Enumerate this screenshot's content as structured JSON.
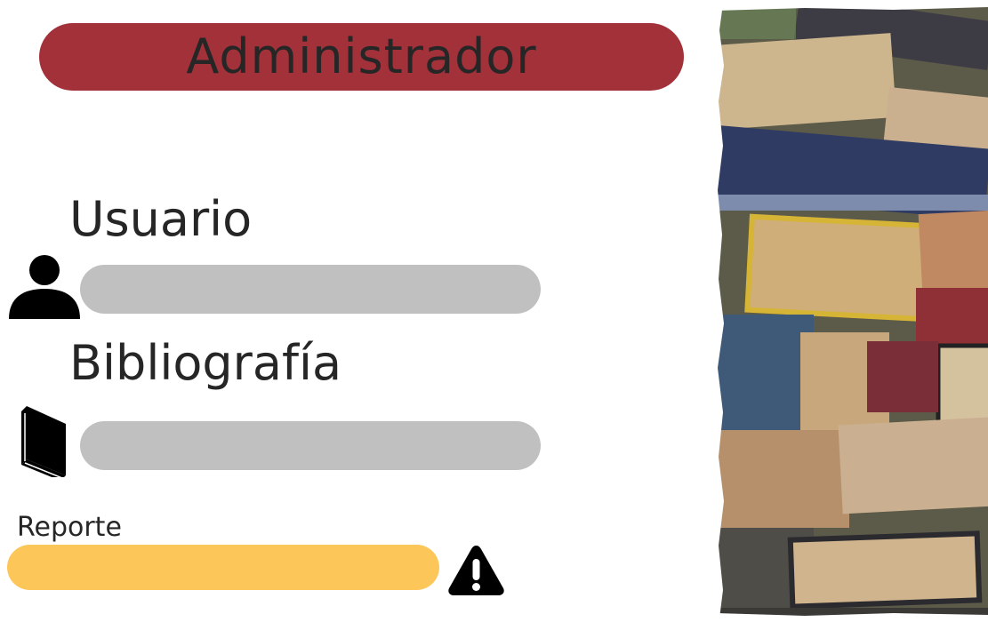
{
  "header": {
    "title": "Administrador"
  },
  "form": {
    "usuario_label": "Usuario",
    "usuario_value": "",
    "bibliografia_label": "Bibliografía",
    "bibliografia_value": "",
    "reporte_label": "Reporte",
    "reporte_value": ""
  },
  "icons": {
    "user": "user-icon",
    "book": "book-icon",
    "warning": "warning-icon"
  },
  "colors": {
    "header_bg": "#a2313a",
    "field_bg": "#c0c0c0",
    "report_bg": "#fdc659",
    "text": "#262626"
  }
}
